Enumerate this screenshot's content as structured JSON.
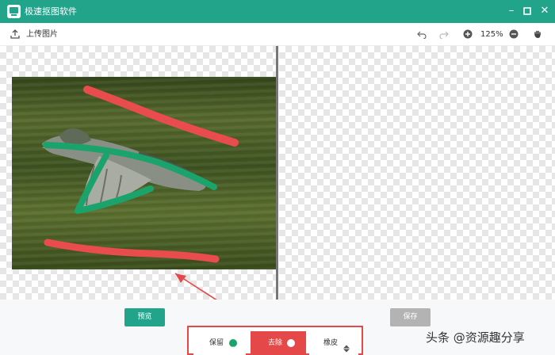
{
  "window": {
    "title": "极速抠图软件"
  },
  "toolbar": {
    "upload_label": "上传图片",
    "zoom_level": "125%"
  },
  "actions": {
    "preview_label": "预览",
    "save_label": "保存"
  },
  "modes": {
    "keep_label": "保留",
    "remove_label": "去除",
    "erase_label": "橡皮",
    "selected": "去除"
  },
  "watermark": {
    "text": "头条 @资源趣分享"
  },
  "colors": {
    "accent": "#22a48b",
    "remove_red": "#e54848",
    "keep_green": "#1aa36a"
  }
}
